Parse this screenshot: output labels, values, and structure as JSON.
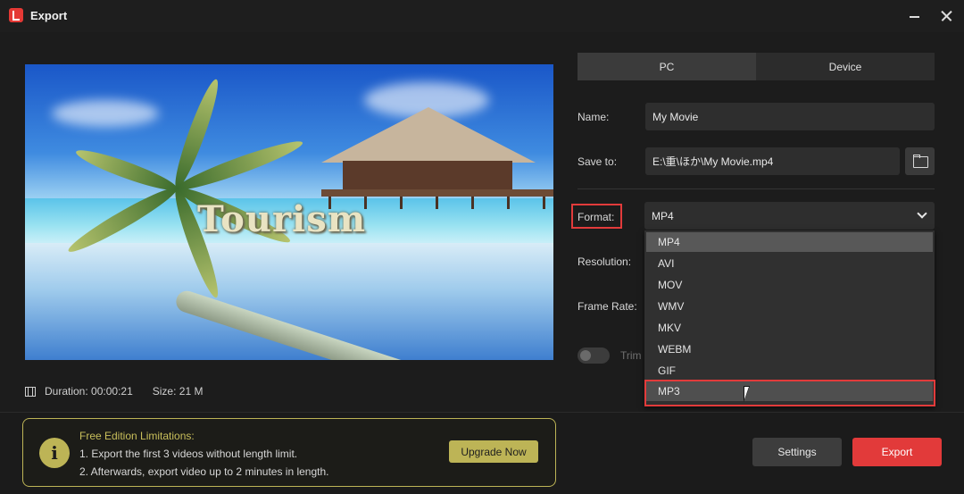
{
  "window": {
    "title": "Export"
  },
  "preview": {
    "overlay_text": "Tourism",
    "duration_label": "Duration:",
    "duration_value": "00:00:21",
    "size_label": "Size:",
    "size_value": "21 M"
  },
  "tabs": [
    {
      "label": "PC",
      "active": true
    },
    {
      "label": "Device",
      "active": false
    }
  ],
  "fields": {
    "name_label": "Name:",
    "name_value": "My Movie",
    "save_to_label": "Save to:",
    "save_to_value": "E:\\重\\ほか\\My Movie.mp4",
    "format_label": "Format:",
    "format_value": "MP4",
    "resolution_label": "Resolution:",
    "frame_rate_label": "Frame Rate:",
    "trim_label": "Trim"
  },
  "format_options": [
    "MP4",
    "AVI",
    "MOV",
    "WMV",
    "MKV",
    "WEBM",
    "GIF",
    "MP3"
  ],
  "format_selected": "MP4",
  "format_hovered": "MP3",
  "limitations": {
    "title": "Free Edition Limitations:",
    "line1": "1. Export the first 3 videos without length limit.",
    "line2": "2. Afterwards, export video up to 2 minutes in length.",
    "upgrade_label": "Upgrade Now",
    "info_glyph": "i"
  },
  "actions": {
    "settings_label": "Settings",
    "export_label": "Export"
  },
  "colors": {
    "accent": "#e23a3a",
    "highlight": "#bdb456"
  }
}
